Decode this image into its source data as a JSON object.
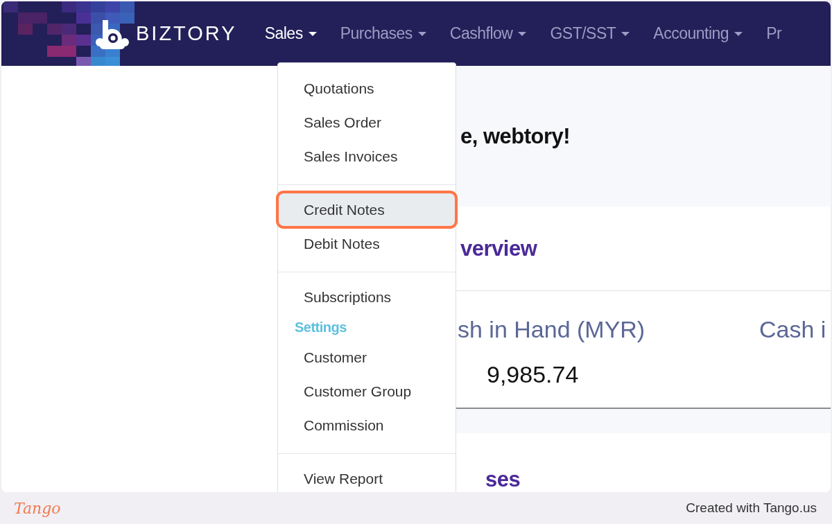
{
  "navbar": {
    "brand": "BIZTORY",
    "menus": [
      {
        "label": "Sales",
        "active": true,
        "caret": true
      },
      {
        "label": "Purchases",
        "active": false,
        "caret": true
      },
      {
        "label": "Cashflow",
        "active": false,
        "caret": true
      },
      {
        "label": "GST/SST",
        "active": false,
        "caret": true
      },
      {
        "label": "Accounting",
        "active": false,
        "caret": true
      },
      {
        "label": "Pr",
        "active": false,
        "caret": false
      }
    ]
  },
  "dropdown": {
    "items": [
      {
        "kind": "item",
        "label": "Quotations",
        "selected": false
      },
      {
        "kind": "item",
        "label": "Sales Order",
        "selected": false
      },
      {
        "kind": "item",
        "label": "Sales Invoices",
        "selected": false
      },
      {
        "kind": "divider"
      },
      {
        "kind": "item",
        "label": "Credit Notes",
        "selected": true
      },
      {
        "kind": "item",
        "label": "Debit Notes",
        "selected": false
      },
      {
        "kind": "divider"
      },
      {
        "kind": "item",
        "label": "Subscriptions",
        "selected": false
      },
      {
        "kind": "header",
        "label": "Settings"
      },
      {
        "kind": "item",
        "label": "Customer",
        "selected": false
      },
      {
        "kind": "item",
        "label": "Customer Group",
        "selected": false
      },
      {
        "kind": "item",
        "label": "Commission",
        "selected": false
      },
      {
        "kind": "divider"
      },
      {
        "kind": "item",
        "label": "View Report",
        "selected": false
      }
    ]
  },
  "greeting": "e, webtory!",
  "overview": {
    "title": "verview",
    "stats": [
      {
        "label": "sh in Hand (MYR)",
        "value": "9,985.74"
      },
      {
        "label": "Cash i"
      }
    ]
  },
  "section_2": {
    "title": "ses"
  },
  "footer": {
    "logo": "Tango",
    "credit": "Created with Tango.us"
  }
}
